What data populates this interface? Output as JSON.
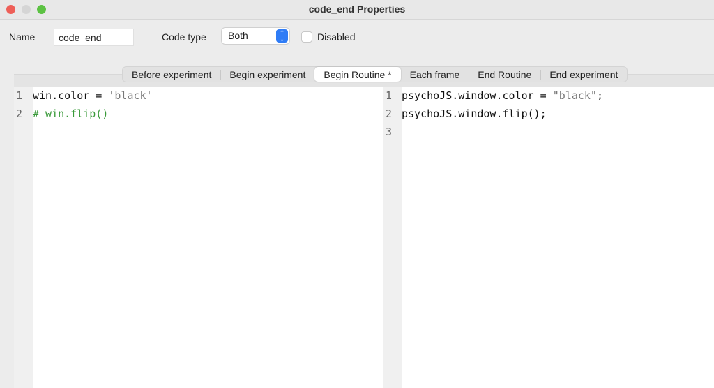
{
  "window": {
    "title": "code_end Properties",
    "controls": {
      "close": "#ee5f58",
      "minimize": "#d5d5d5",
      "zoom": "#5cc243"
    }
  },
  "form": {
    "name_label": "Name",
    "name_value": "code_end",
    "code_type_label": "Code type",
    "code_type_value": "Both",
    "disabled_label": "Disabled"
  },
  "tabs": [
    {
      "label": "Before experiment"
    },
    {
      "label": "Begin experiment"
    },
    {
      "label": "Begin Routine *"
    },
    {
      "label": "Each frame"
    },
    {
      "label": "End Routine"
    },
    {
      "label": "End experiment"
    }
  ],
  "python": {
    "line_numbers": [
      "1",
      "2"
    ],
    "line1_code": "win.color = ",
    "line1_str": "'black'",
    "line2_comment": "# win.flip()"
  },
  "js": {
    "line_numbers": [
      "1",
      "2",
      "3"
    ],
    "line1_code": "psychoJS.window.color = ",
    "line1_str": "\"black\"",
    "line1_end": ";",
    "line2_code": "psychoJS.window.flip();"
  }
}
